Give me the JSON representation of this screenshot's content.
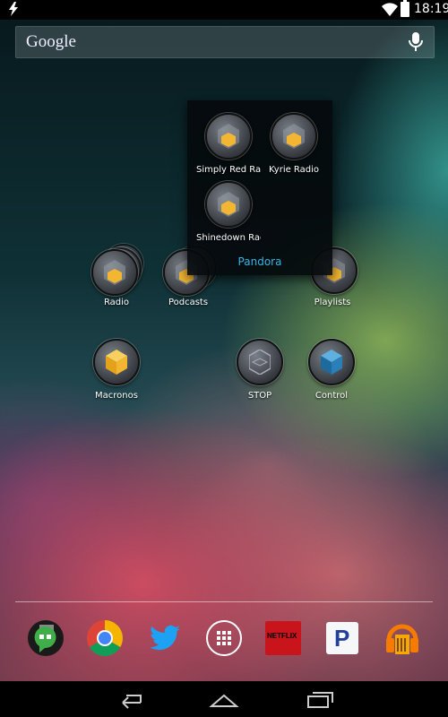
{
  "status_bar": {
    "time": "18:19"
  },
  "search": {
    "label": "Google"
  },
  "folder": {
    "name": "Pandora",
    "items": [
      {
        "label": "Simply Red Radio"
      },
      {
        "label": "Kyrie Radio"
      },
      {
        "label": "Shinedown Radio"
      }
    ]
  },
  "home": {
    "radio": "Radio",
    "podcasts": "Podcasts",
    "playlists": "Playlists",
    "macronos": "Macronos",
    "stop": "STOP",
    "control": "Control"
  },
  "dock": {
    "hangouts": "hangouts-icon",
    "chrome": "chrome-icon",
    "twitter": "twitter-icon",
    "apps": "all-apps-icon",
    "netflix_text": "NETFLIX",
    "pandora_text": "P",
    "music": "play-music-icon"
  },
  "colors": {
    "folder_title": "#33b5e5",
    "cube_yellow": "#f2b632",
    "cube_blue": "#2a7fb8"
  }
}
